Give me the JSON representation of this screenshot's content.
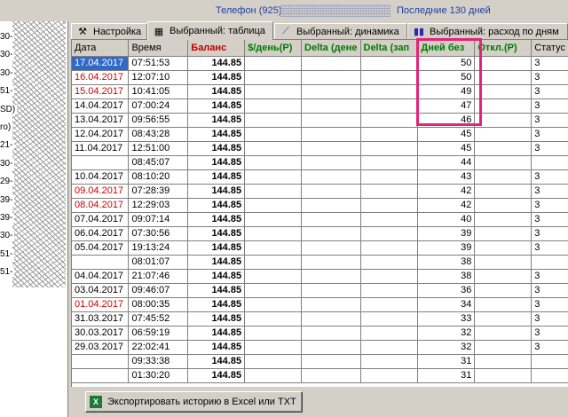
{
  "top": {
    "phone_label": "Телефон (925)",
    "days_label": "Последние 130 дней"
  },
  "left_panel": {
    "rows": [
      "30-",
      "30-",
      "30-",
      "51-",
      "SD)",
      "ro)",
      "21-",
      "30-",
      "29-",
      "39-",
      "39-",
      "30-",
      "51-",
      "51-"
    ]
  },
  "tabs": [
    {
      "label": "Настройка",
      "icon": "tools-icon"
    },
    {
      "label": "Выбранный: таблица",
      "icon": "table-icon"
    },
    {
      "label": "Выбранный: динамика",
      "icon": "line-chart-icon"
    },
    {
      "label": "Выбранный: расход по дням",
      "icon": "bar-chart-icon"
    }
  ],
  "columns": [
    "Дата",
    "Время",
    "Баланс",
    "$/день(Р)",
    "Delta (дене",
    "Delta (зап",
    "Дней без",
    "Откл.(Р)",
    "Статус"
  ],
  "rows": [
    {
      "date": "17.04.2017",
      "time": "07:51:53",
      "balance": "144.85",
      "days": "50",
      "status": "3",
      "red": true,
      "selected": true
    },
    {
      "date": "16.04.2017",
      "time": "12:07:10",
      "balance": "144.85",
      "days": "50",
      "status": "3",
      "red": true
    },
    {
      "date": "15.04.2017",
      "time": "10:41:05",
      "balance": "144.85",
      "days": "49",
      "status": "3",
      "red": true
    },
    {
      "date": "14.04.2017",
      "time": "07:00:24",
      "balance": "144.85",
      "days": "47",
      "status": "3"
    },
    {
      "date": "13.04.2017",
      "time": "09:56:55",
      "balance": "144.85",
      "days": "46",
      "status": "3"
    },
    {
      "date": "12.04.2017",
      "time": "08:43:28",
      "balance": "144.85",
      "days": "45",
      "status": "3"
    },
    {
      "date": "11.04.2017",
      "time": "12:51:00",
      "balance": "144.85",
      "days": "45",
      "status": "3"
    },
    {
      "date": "",
      "time": "08:45:07",
      "balance": "144.85",
      "days": "44",
      "status": ""
    },
    {
      "date": "10.04.2017",
      "time": "08:10:20",
      "balance": "144.85",
      "days": "43",
      "status": "3"
    },
    {
      "date": "09.04.2017",
      "time": "07:28:39",
      "balance": "144.85",
      "days": "42",
      "status": "3",
      "red": true
    },
    {
      "date": "08.04.2017",
      "time": "12:29:03",
      "balance": "144.85",
      "days": "42",
      "status": "3",
      "red": true
    },
    {
      "date": "07.04.2017",
      "time": "09:07:14",
      "balance": "144.85",
      "days": "40",
      "status": "3"
    },
    {
      "date": "06.04.2017",
      "time": "07:30:56",
      "balance": "144.85",
      "days": "39",
      "status": "3"
    },
    {
      "date": "05.04.2017",
      "time": "19:13:24",
      "balance": "144.85",
      "days": "39",
      "status": "3"
    },
    {
      "date": "",
      "time": "08:01:07",
      "balance": "144.85",
      "days": "38",
      "status": ""
    },
    {
      "date": "04.04.2017",
      "time": "21:07:46",
      "balance": "144.85",
      "days": "38",
      "status": "3"
    },
    {
      "date": "03.04.2017",
      "time": "09:46:07",
      "balance": "144.85",
      "days": "36",
      "status": "3"
    },
    {
      "date": "01.04.2017",
      "time": "08:00:35",
      "balance": "144.85",
      "days": "34",
      "status": "3",
      "red": true
    },
    {
      "date": "31.03.2017",
      "time": "07:45:52",
      "balance": "144.85",
      "days": "33",
      "status": "3"
    },
    {
      "date": "30.03.2017",
      "time": "06:59:19",
      "balance": "144.85",
      "days": "32",
      "status": "3"
    },
    {
      "date": "29.03.2017",
      "time": "22:02:41",
      "balance": "144.85",
      "days": "32",
      "status": "3"
    },
    {
      "date": "",
      "time": "09:33:38",
      "balance": "144.85",
      "days": "31",
      "status": ""
    },
    {
      "date": "",
      "time": "01:30:20",
      "balance": "144.85",
      "days": "31",
      "status": ""
    }
  ],
  "export_button": "Экспортировать историю в Excel или TXT",
  "colors": {
    "highlight": "#e3237a",
    "selection": "#3169c6",
    "weekend_red": "#d00000",
    "header_green": "#007a00"
  }
}
